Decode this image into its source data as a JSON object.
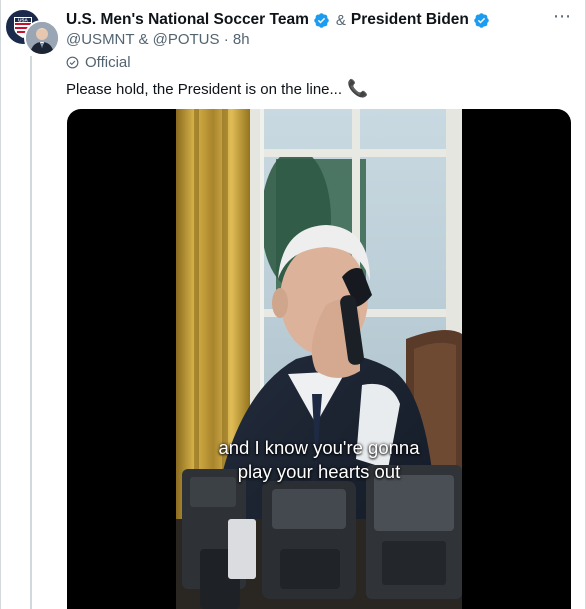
{
  "tweet": {
    "author_primary": "U.S. Men's National Soccer Team",
    "ampersand": "&",
    "author_secondary": "President Biden",
    "handles": "@USMNT & @POTUS",
    "separator": "·",
    "time": "8h",
    "official_label": "Official",
    "text": "Please hold, the President is on the line...",
    "text_emoji": "📞",
    "more_icon": "⋯",
    "avatar_badge": "USA"
  },
  "media": {
    "caption_line1": "and I know you're gonna",
    "caption_line2": "play your hearts out"
  },
  "colors": {
    "verified_blue": "#1d9bf0",
    "secondary_text": "#536471",
    "media_bg": "#000000"
  }
}
